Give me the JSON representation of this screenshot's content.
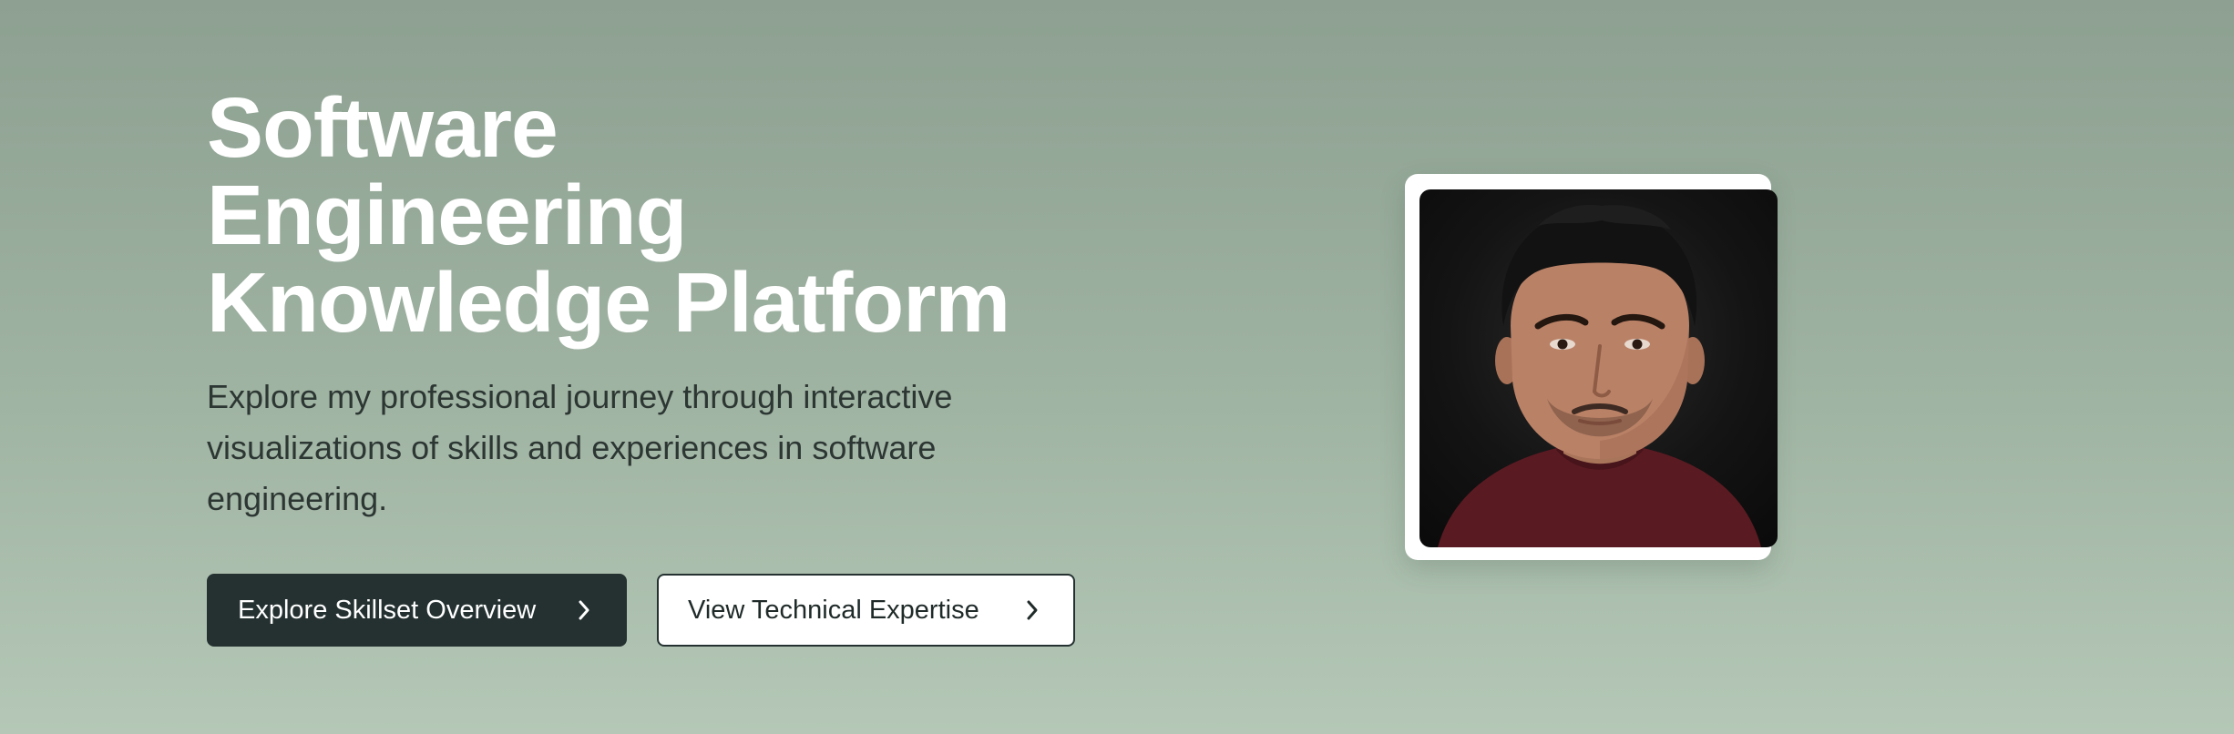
{
  "hero": {
    "title_lines": [
      "Software",
      "Engineering",
      "Knowledge Platform"
    ],
    "subtitle": "Explore my professional journey through interactive visualizations of skills and experiences in software engineering.",
    "primary_button": {
      "label": "Explore Skillset Overview",
      "icon": "chevron-right-icon"
    },
    "secondary_button": {
      "label": "View Technical Expertise",
      "icon": "chevron-right-icon"
    },
    "photo": {
      "subject": "portrait-photo"
    }
  },
  "colors": {
    "background_top": "#8da091",
    "background_bottom": "#b5c8b7",
    "title": "#ffffff",
    "subtitle": "#2c3633",
    "primary_button_bg": "#253131",
    "secondary_button_bg": "#ffffff",
    "photo_frame": "#ffffff"
  }
}
